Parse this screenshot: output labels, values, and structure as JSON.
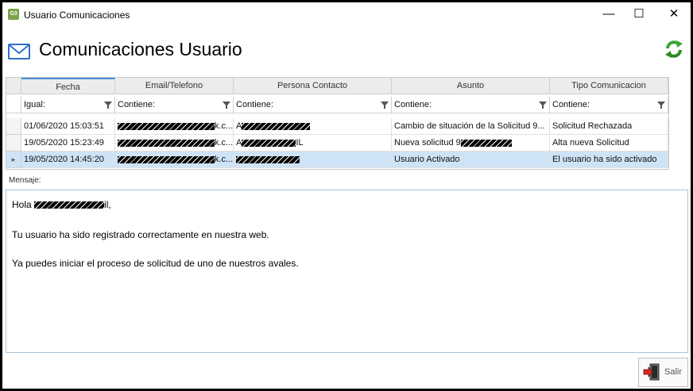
{
  "window": {
    "app_icon_text": "G3",
    "title": "Usuario Comunicaciones",
    "minimize": "—",
    "maximize": "☐",
    "close": "✕"
  },
  "header": {
    "title": "Comunicaciones Usuario"
  },
  "grid": {
    "columns": [
      "Fecha",
      "Email/Telefono",
      "Persona Contacto",
      "Asunto",
      "Tipo Comunicacion"
    ],
    "filters": [
      "Igual:",
      "Contiene:",
      "Contiene:",
      "Contiene:",
      "Contiene:"
    ],
    "rows": [
      {
        "fecha": "01/06/2020 15:03:51",
        "email_suffix": "k.c...",
        "persona_prefix": "A",
        "asunto": "Cambio de situación de la Solicitud 9...",
        "tipo": "Solicitud Rechazada"
      },
      {
        "fecha": "19/05/2020 15:23:49",
        "email_suffix": "k.c...",
        "persona_prefix": "A",
        "persona_suffix": "IL",
        "asunto": "Nueva solicitud 9",
        "tipo": "Alta nueva Solicitud"
      },
      {
        "fecha": "19/05/2020 14:45:20",
        "email_suffix": "k.c...",
        "persona_prefix": "",
        "asunto": "Usuario Activado",
        "tipo": "El usuario ha sido activado"
      }
    ],
    "selected_row": 2,
    "selected_row_marker": "▸"
  },
  "message": {
    "label": "Mensaje:",
    "greeting_prefix": "Hola",
    "greeting_suffix": "il,",
    "line1": "Tu usuario ha sido registrado correctamente en nuestra web.",
    "line2": "Ya puedes iniciar el proceso de solicitud de uno de nuestros avales."
  },
  "footer": {
    "exit_label": "Salir"
  },
  "colors": {
    "selection": "#cfe3f6",
    "mail_icon": "#2f6fc9",
    "refresh_icon": "#3fa335"
  }
}
